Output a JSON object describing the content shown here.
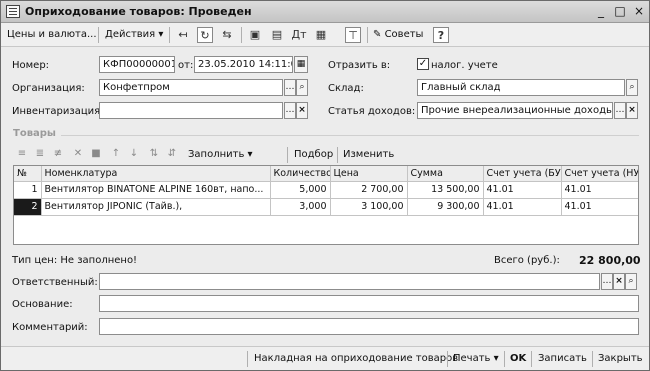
{
  "window": {
    "title": "Оприходование товаров: Проведен",
    "controls": {
      "minimize": "_",
      "maximize": "□",
      "close": "×"
    }
  },
  "toolbar": {
    "prices_menu": "Цены и валюта...",
    "actions_menu": "Действия",
    "tips_label": "Советы",
    "help_label": "?"
  },
  "header": {
    "number_label": "Номер:",
    "number_value": "КФП00000001",
    "date_label": "от:",
    "date_value": "23.05.2010 14:11:00",
    "reflect_label": "Отразить в:",
    "tax_checkbox_label": "налог. учете",
    "tax_checked": true,
    "org_label": "Организация:",
    "org_value": "Конфетпром",
    "warehouse_label": "Склад:",
    "warehouse_value": "Главный склад",
    "inventory_label": "Инвентаризация:",
    "inventory_value": "",
    "income_label": "Статья доходов:",
    "income_value": "Прочие внереализационные доходы (ра"
  },
  "goods": {
    "section_title": "Товары",
    "fill_label": "Заполнить",
    "select_label": "Подбор",
    "change_label": "Изменить",
    "columns": [
      "№",
      "Номенклатура",
      "Количество",
      "Цена",
      "Сумма",
      "Счет учета (БУ)",
      "Счет учета (НУ)"
    ],
    "rows": [
      {
        "n": "1",
        "item": "Вентилятор BINATONE ALPINE 160вт, напо...",
        "qty": "5,000",
        "price": "2 700,00",
        "sum": "13 500,00",
        "acc_bu": "41.01",
        "acc_nu": "41.01"
      },
      {
        "n": "2",
        "item": "Вентилятор JIPONIC (Тайв.),",
        "qty": "3,000",
        "price": "3 100,00",
        "sum": "9 300,00",
        "acc_bu": "41.01",
        "acc_nu": "41.01"
      }
    ]
  },
  "footer": {
    "price_type": "Тип цен: Не заполнено!",
    "total_label": "Всего (руб.):",
    "total_value": "22 800,00",
    "responsible_label": "Ответственный:",
    "responsible_value": "",
    "basis_label": "Основание:",
    "basis_value": "",
    "comment_label": "Комментарий:",
    "comment_value": ""
  },
  "bottom": {
    "invoice_label": "Накладная на оприходование товаров",
    "print_label": "Печать",
    "ok_label": "OK",
    "save_label": "Записать",
    "close_label": "Закрыть"
  }
}
